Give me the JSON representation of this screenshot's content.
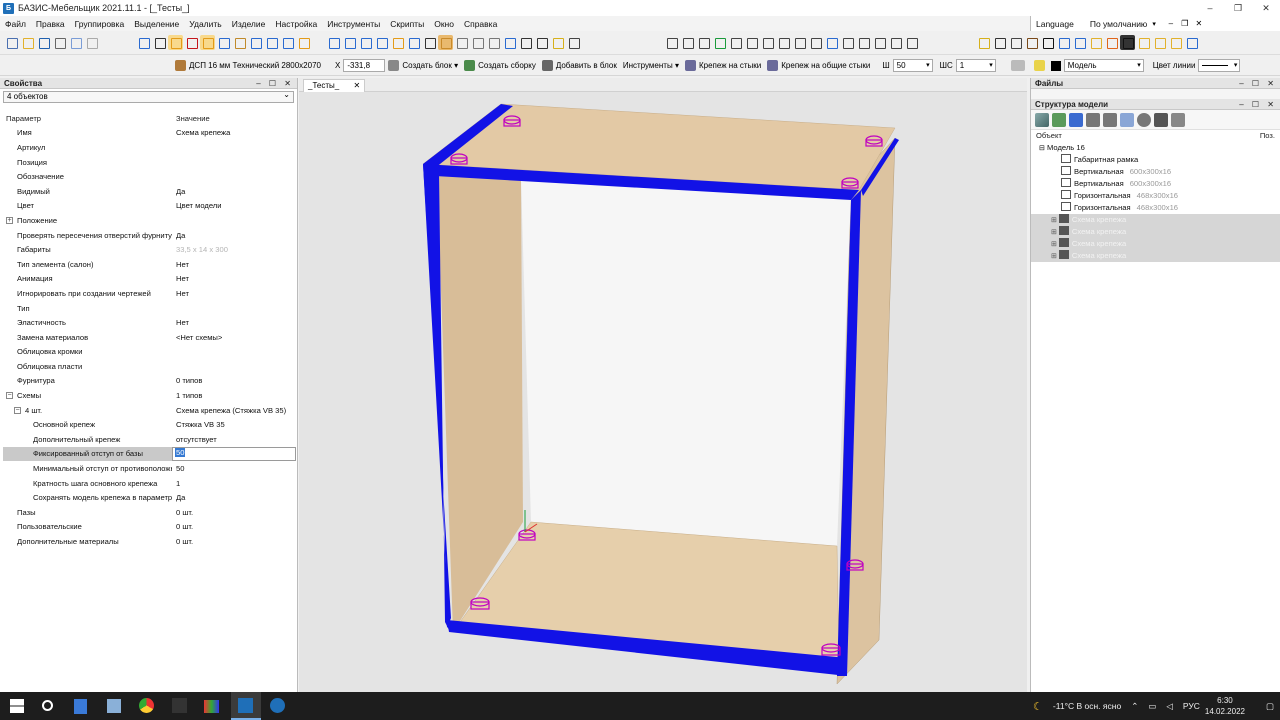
{
  "window": {
    "title": "БАЗИС-Мебельщик 2021.11.1 - [_Тесты_]",
    "controls": [
      "–",
      "❐",
      "✕"
    ]
  },
  "menu": {
    "items": [
      "Файл",
      "Правка",
      "Группировка",
      "Выделение",
      "Удалить",
      "Изделие",
      "Настройка",
      "Инструменты",
      "Скрипты",
      "Окно",
      "Справка"
    ],
    "language": "Language",
    "layout": "По умолчанию",
    "mdi_controls": [
      "–",
      "❐",
      "✕"
    ]
  },
  "toolbar2": {
    "material": "ДСП 16 мм Технический 2800x2070",
    "x_label": "X",
    "x_value": "-331,8",
    "create_block": "Создать блок",
    "create_assembly": "Создать сборку",
    "add_to_block": "Добавить в блок",
    "tools": "Инструменты",
    "fastener_joints": "Крепеж на стыки",
    "fastener_common": "Крепеж на общие стыки",
    "w_label": "Ш",
    "w_value": "50",
    "shs_label": "ШС",
    "shs_value": "1",
    "color_source": "Модель",
    "line_color": "Цвет линии"
  },
  "properties": {
    "title": "Свойства",
    "controls": "– ☐ ✕",
    "selector": "4 объектов",
    "col_param": "Параметр",
    "col_value": "Значение",
    "rows": [
      {
        "name": "Имя",
        "value": "Схема крепежа"
      },
      {
        "name": "Артикул",
        "value": ""
      },
      {
        "name": "Позиция",
        "value": ""
      },
      {
        "name": "Обозначение",
        "value": ""
      },
      {
        "name": "Видимый",
        "value": "Да"
      },
      {
        "name": "Цвет",
        "value": "Цвет модели"
      },
      {
        "name": "Положение",
        "value": "",
        "expander": "+"
      },
      {
        "name": "Проверять пересечения отверстий фурнитуры",
        "value": "Да"
      },
      {
        "name": "Габариты",
        "value": "33,5 x 14 x 300",
        "gray": true
      },
      {
        "name": "Тип элемента (салон)",
        "value": "Нет"
      },
      {
        "name": "Анимация",
        "value": "Нет"
      },
      {
        "name": "Игнорировать при создании чертежей",
        "value": "Нет"
      },
      {
        "name": "Тип",
        "value": ""
      },
      {
        "name": "Эластичность",
        "value": "Нет"
      },
      {
        "name": "Замена материалов",
        "value": "<Нет схемы>"
      },
      {
        "name": "Облицовка кромки",
        "value": ""
      },
      {
        "name": "Облицовка пласти",
        "value": ""
      },
      {
        "name": "Фурнитура",
        "value": "0 типов"
      },
      {
        "name": "Схемы",
        "value": "1 типов",
        "expander": "−"
      },
      {
        "name": "4 шт.",
        "value": "Схема крепежа (Стяжка VB 35)",
        "expander": "−",
        "indent": 1
      },
      {
        "name": "Основной крепеж",
        "value": "Стяжка VB 35",
        "indent": 2
      },
      {
        "name": "Дополнительный крепеж",
        "value": "отсутствует",
        "indent": 2
      },
      {
        "name": "Фиксированный отступ от базы",
        "value": "50",
        "indent": 2,
        "editing": true
      },
      {
        "name": "Минимальный отступ от противоположного края",
        "value": "50",
        "indent": 2
      },
      {
        "name": "Кратность шага основного крепежа",
        "value": "1",
        "indent": 2
      },
      {
        "name": "Сохранять модель крепежа в параметрах",
        "value": "Да",
        "indent": 2
      },
      {
        "name": "Пазы",
        "value": "0 шт."
      },
      {
        "name": "Пользовательские",
        "value": "0 шт."
      },
      {
        "name": "Дополнительные материалы",
        "value": "0 шт."
      }
    ]
  },
  "viewport": {
    "tab_label": "_Тесты_",
    "tab_close": "✕"
  },
  "files_panel": {
    "title": "Файлы",
    "controls": "– ☐ ✕"
  },
  "structure": {
    "title": "Структура модели",
    "controls": "– ☐ ✕",
    "col_object": "Объект",
    "col_pos": "Поз.",
    "root": "Модель 16",
    "items": [
      {
        "label": "Габаритная рамка",
        "dim": ""
      },
      {
        "label": "Вертикальная",
        "dim": "600x300x16"
      },
      {
        "label": "Вертикальная",
        "dim": "600x300x16"
      },
      {
        "label": "Горизонтальная",
        "dim": "468x300x16"
      },
      {
        "label": "Горизонтальная",
        "dim": "468x300x16"
      }
    ],
    "faded_items": [
      "Схема крепежа",
      "Схема крепежа",
      "Схема крепежа",
      "Схема крепежа"
    ]
  },
  "taskbar": {
    "weather": "-11°C  В осн. ясно",
    "lang": "РУС",
    "time": "6:30",
    "date": "14.02.2022"
  },
  "colors": {
    "accent_blue": "#1212e6",
    "fastener_magenta": "#c000c0",
    "wood": "#e3c9a5"
  }
}
